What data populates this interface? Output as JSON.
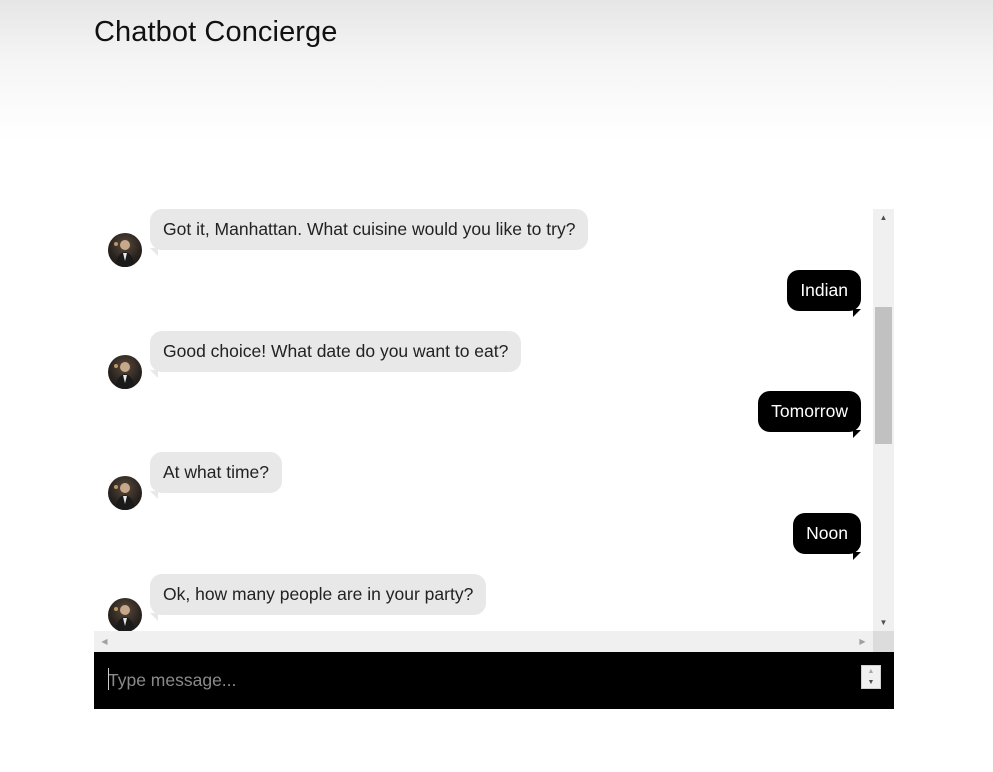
{
  "app": {
    "title": "Chatbot Concierge"
  },
  "chat": {
    "messages": [
      {
        "sender": "bot",
        "text": "Got it, Manhattan. What cuisine would you like to try?"
      },
      {
        "sender": "user",
        "text": "Indian"
      },
      {
        "sender": "bot",
        "text": "Good choice! What date do you want to eat?"
      },
      {
        "sender": "user",
        "text": "Tomorrow"
      },
      {
        "sender": "bot",
        "text": "At what time?"
      },
      {
        "sender": "user",
        "text": "Noon"
      },
      {
        "sender": "bot",
        "text": "Ok, how many people are in your party?"
      }
    ]
  },
  "composer": {
    "placeholder": "Type message..."
  },
  "icons": {
    "scroll_up": "triangle-up-icon",
    "scroll_down": "triangle-down-icon",
    "scroll_left": "triangle-left-icon",
    "scroll_right": "triangle-right-icon",
    "avatar": "bot-avatar-photo"
  },
  "colors": {
    "bot_bubble": "#e8e8e8",
    "user_bubble": "#000000",
    "input_bar": "#000000"
  }
}
